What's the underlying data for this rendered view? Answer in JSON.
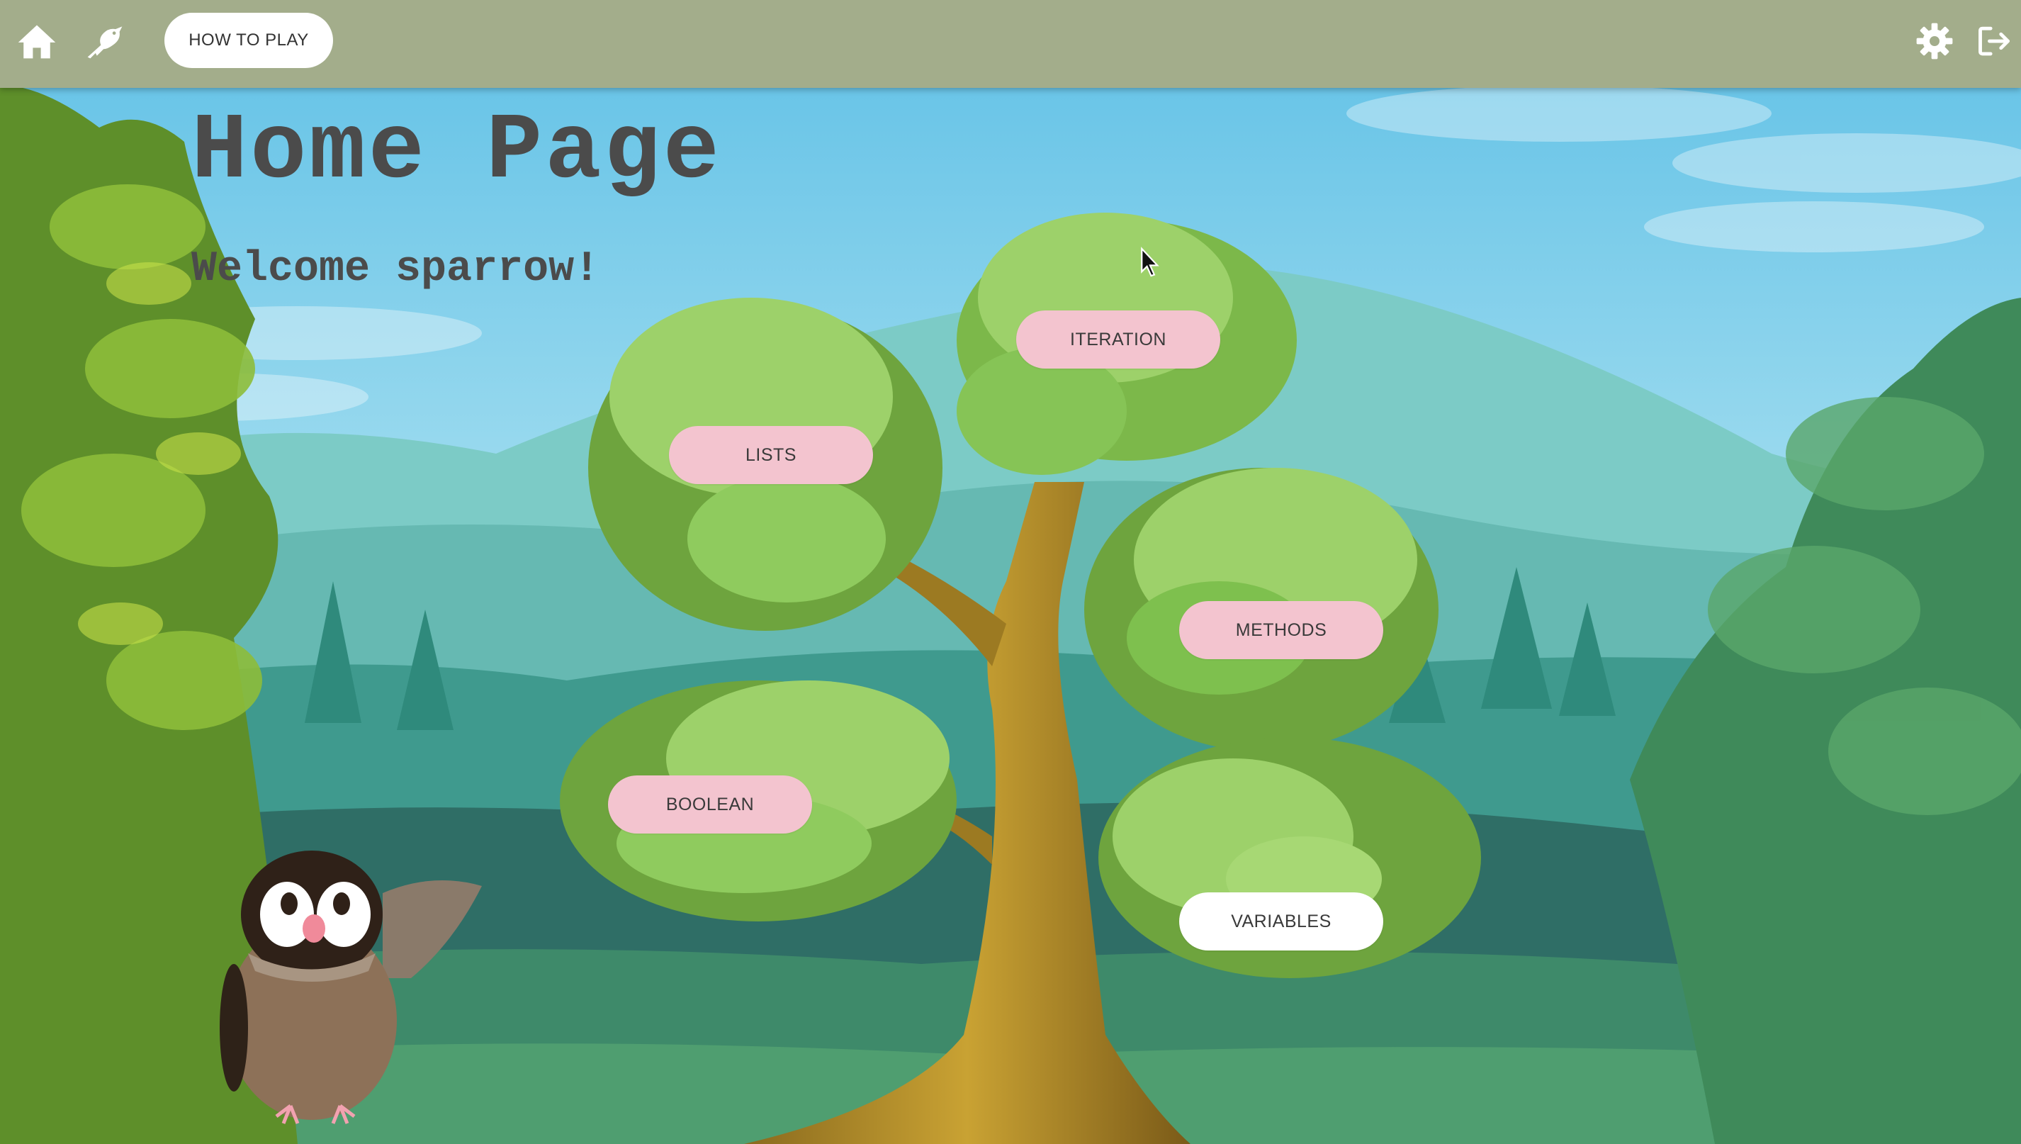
{
  "nav": {
    "home_icon": "home-icon",
    "bird_icon": "bird-icon",
    "how_to_play_label": "HOW TO PLAY",
    "settings_icon": "gear-icon",
    "logout_icon": "logout-icon"
  },
  "page": {
    "title": "Home Page",
    "welcome": "Welcome sparrow!"
  },
  "topics": {
    "iteration": "ITERATION",
    "lists": "LISTS",
    "methods": "METHODS",
    "boolean": "BOOLEAN",
    "variables": "VARIABLES"
  },
  "colors": {
    "topbar": "#a3ad8b",
    "topic_button": "#f3c4cf",
    "topic_button_done": "#ffffff",
    "title_text": "#4b4b4b"
  }
}
